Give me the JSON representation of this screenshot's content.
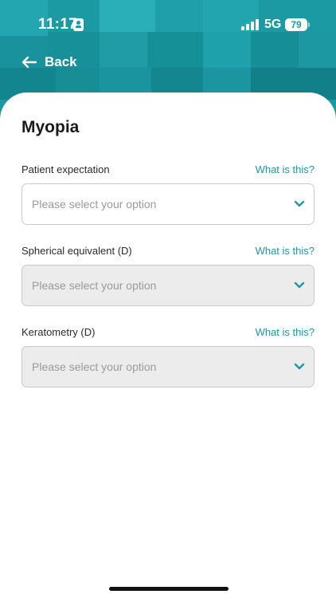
{
  "status_bar": {
    "time": "11:17",
    "network": "5G",
    "battery": "79"
  },
  "nav": {
    "back_label": "Back"
  },
  "page": {
    "title": "Myopia"
  },
  "fields": [
    {
      "label": "Patient expectation",
      "help": "What is this?",
      "placeholder": "Please select your option",
      "enabled": true
    },
    {
      "label": "Spherical equivalent (D)",
      "help": "What is this?",
      "placeholder": "Please select your option",
      "enabled": false
    },
    {
      "label": "Keratometry (D)",
      "help": "What is this?",
      "placeholder": "Please select your option",
      "enabled": false
    }
  ],
  "colors": {
    "accent": "#1e97a3",
    "header": "#1c9aa4",
    "disabled_field": "#ececec"
  },
  "icons": {
    "back": "arrow-left-icon",
    "dropdown": "chevron-down-icon",
    "contact": "id-card-icon"
  }
}
